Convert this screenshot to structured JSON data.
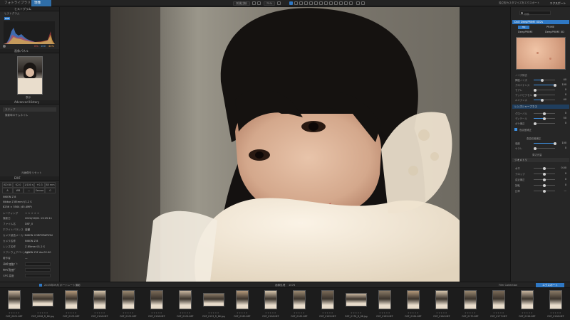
{
  "topbar": {
    "tabs": [
      {
        "label": "フォトライブラリ"
      },
      {
        "label": "現像"
      }
    ],
    "compare_label": "前後比較",
    "fit_label": "75%",
    "export_label": "独立型カスタマイズをエクスポート",
    "export_btn": "エクスポート"
  },
  "left": {
    "histogram_header": "ヒストグラム",
    "histogram_title": "ヒストグラム",
    "rgb_label": "RGB",
    "hist_values": [
      "0%",
      "100",
      "40%"
    ],
    "navigator_header": "画像パネル",
    "navigator_caption": "表示",
    "history_header": "Advanced History",
    "history_items": [
      "ステップ",
      "撮影時のサムネイル"
    ],
    "history_sub": "",
    "save_label": "元画像をリセット",
    "exif_header": "EXIF",
    "exif_cells": [
      "ISO 80",
      "f/2.0",
      "1/100 s",
      "+0.3 EV",
      "85 mm"
    ],
    "exif_cells2": [
      "A",
      "WB",
      "—",
      "Sensor",
      "0"
    ],
    "camera": "NIKON Z 8",
    "lens": "Nikkor Z 85mm f/1.2 S",
    "dims": "8256 × 5504 (45.4MP)",
    "rating_label": "レーティング",
    "rows": [
      {
        "k": "撮影日",
        "v": "2024/10/01 13:25:11"
      },
      {
        "k": "ファイル名",
        "v": "DSF_0"
      },
      {
        "k": "ホワイトバランス",
        "v": "自動"
      },
      {
        "k": "カメラ製造メーカー",
        "v": "NIKON CORPORATION"
      },
      {
        "k": "カメラ名称",
        "v": "NIKON Z 8"
      },
      {
        "k": "レンズ名称",
        "v": "Z 85mm f/1.2 S"
      },
      {
        "k": "ソフトウェアバージョン",
        "v": "NIKON Z 8 Ver.02.00"
      },
      {
        "k": "著作者",
        "v": "—"
      },
      {
        "k": "コピーライト",
        "v": "—"
      },
      {
        "k": "キーワード",
        "v": "—"
      }
    ],
    "gps": [
      "GPS 緯度",
      "GPS 経度",
      "GPS 高度"
    ]
  },
  "right": {
    "search_placeholder": "検索",
    "module_title": "DxO DeepPRIME XD2s",
    "options": [
      "HQ",
      "PRIME",
      "DeepPRIME",
      "DeepPRIME XD"
    ],
    "section_noise": "ノイズ除去",
    "sliders": [
      {
        "label": "輝度ノイズ",
        "value": "40"
      },
      {
        "label": "クロミナンス",
        "value": "100"
      },
      {
        "label": "モアレ",
        "value": "0"
      },
      {
        "label": "デッドピクセル",
        "value": "0"
      },
      {
        "label": "ルミナンス",
        "value": "40"
      }
    ],
    "section_lens": "レンズシャープネス",
    "lens_sliders": [
      {
        "label": "グローバル",
        "value": "0"
      },
      {
        "label": "ディテール",
        "value": "50"
      },
      {
        "label": "ボケ補正",
        "value": "0"
      }
    ],
    "chromatic_label": "色収差補正",
    "distortion_label": "歪曲収差補正",
    "dist_sliders": [
      {
        "label": "強度",
        "value": "100"
      },
      {
        "label": "ケラレ",
        "value": "0"
      }
    ],
    "vignette_label": "周辺光量",
    "lower_label": "ジオメトリ",
    "lower_rows": [
      {
        "label": "水平",
        "value": "0.00"
      },
      {
        "label": "クロップ",
        "value": "0"
      },
      {
        "label": "遠近補正",
        "value": "0"
      },
      {
        "label": "回転",
        "value": "0"
      },
      {
        "label": "比率",
        "value": "—"
      }
    ]
  },
  "filmbar": {
    "path": "2025年09月 ポートレート撮影",
    "count": "1076",
    "selection": "画像処理",
    "collection": "Film Collection",
    "export_btn": "エクスポート"
  },
  "thumbs": [
    {
      "name": "DSF_0001.NEF"
    },
    {
      "name": "DSF_0098_R_86.jpg"
    },
    {
      "name": "DSF_0103.NEF"
    },
    {
      "name": "DSF_0106.NEF"
    },
    {
      "name": "DSF_0105.NEF"
    },
    {
      "name": "DSF_0108.NEF"
    },
    {
      "name": "DSF_0109.NEF"
    },
    {
      "name": "DSF_0153_R_86.jpg"
    },
    {
      "name": "DSF_0180.NEF"
    },
    {
      "name": "DSF_0196.NEF"
    },
    {
      "name": "DSF_0162.NEF"
    },
    {
      "name": "DSF_0165.NEF"
    },
    {
      "name": "DSF_0176_R_88.jpg"
    },
    {
      "name": "DSF_0182.NEF"
    },
    {
      "name": "DSF_0184.NEF"
    },
    {
      "name": "DSF_0160.NEF"
    },
    {
      "name": "DSF_0170.NEF"
    },
    {
      "name": "DSF_0177.NEF"
    },
    {
      "name": "DSF_0196.NEF"
    },
    {
      "name": "DSF_0198.NEF"
    }
  ],
  "colors": {
    "accent": "#2f78c4",
    "panel": "#262626",
    "photo_bg": "#6d6a60"
  }
}
